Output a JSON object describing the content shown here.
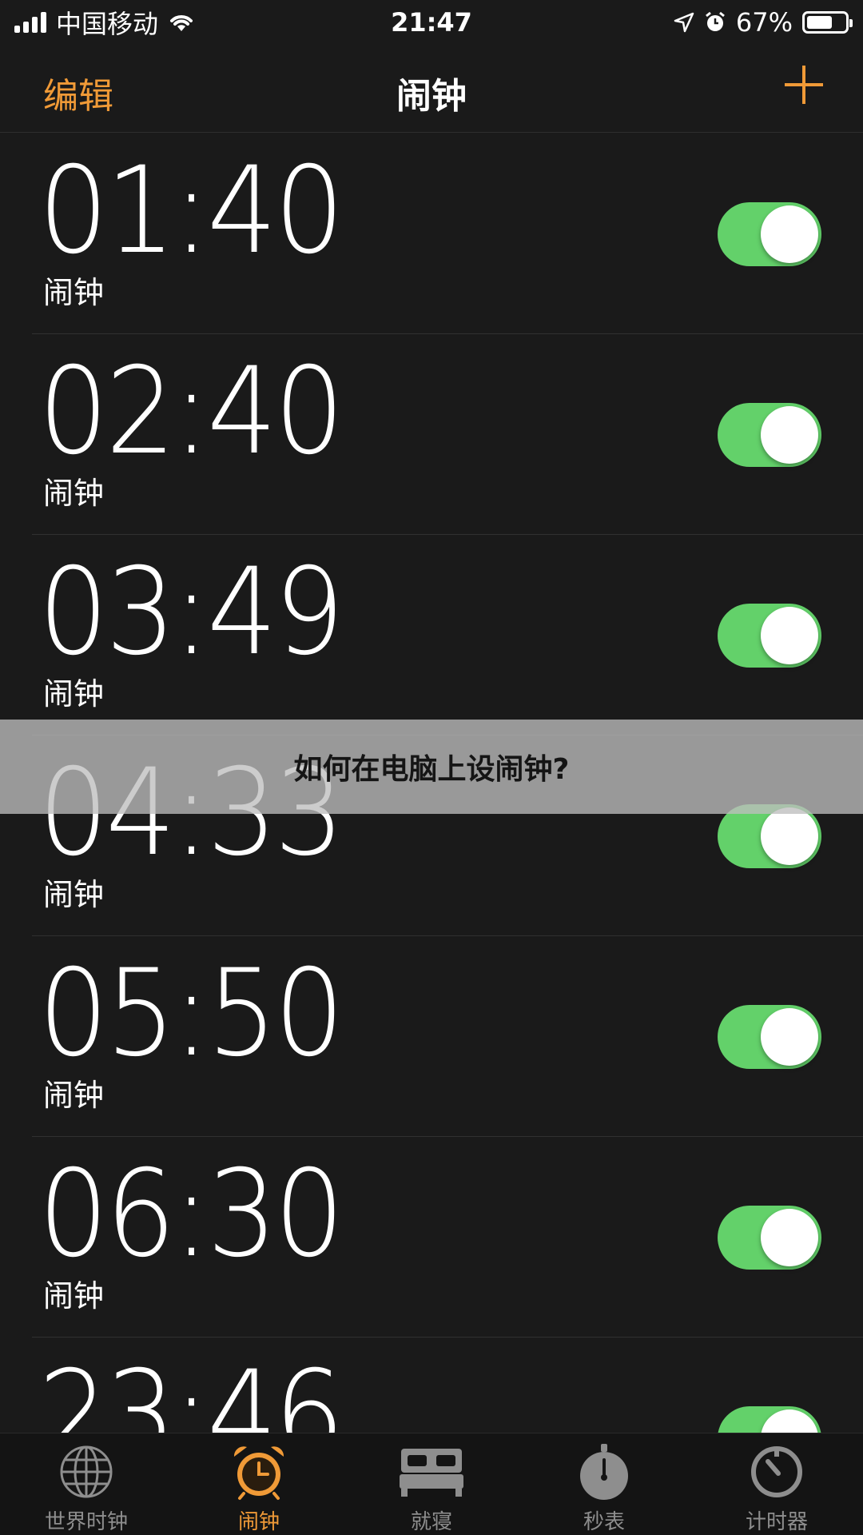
{
  "status_bar": {
    "carrier": "中国移动",
    "time": "21:47",
    "battery": "67%",
    "battery_level": 0.67
  },
  "nav": {
    "edit_label": "编辑",
    "title": "闹钟"
  },
  "alarms": [
    {
      "time": "01:40",
      "label": "闹钟",
      "enabled": true
    },
    {
      "time": "02:40",
      "label": "闹钟",
      "enabled": true
    },
    {
      "time": "03:49",
      "label": "闹钟",
      "enabled": true
    },
    {
      "time": "04:33",
      "label": "闹钟",
      "enabled": true
    },
    {
      "time": "05:50",
      "label": "闹钟",
      "enabled": true
    },
    {
      "time": "06:30",
      "label": "闹钟",
      "enabled": true
    },
    {
      "time": "23:46",
      "label": "",
      "enabled": true
    }
  ],
  "banner": {
    "text": "如何在电脑上设闹钟?"
  },
  "tabs": [
    {
      "label": "世界时钟",
      "icon": "globe-icon",
      "active": false
    },
    {
      "label": "闹钟",
      "icon": "alarm-clock-icon",
      "active": true
    },
    {
      "label": "就寝",
      "icon": "bed-icon",
      "active": false
    },
    {
      "label": "秒表",
      "icon": "stopwatch-icon",
      "active": false
    },
    {
      "label": "计时器",
      "icon": "timer-icon",
      "active": false
    }
  ],
  "colors": {
    "accent": "#f09a37",
    "toggle_on": "#63d16a",
    "background": "#1a1a1a"
  }
}
